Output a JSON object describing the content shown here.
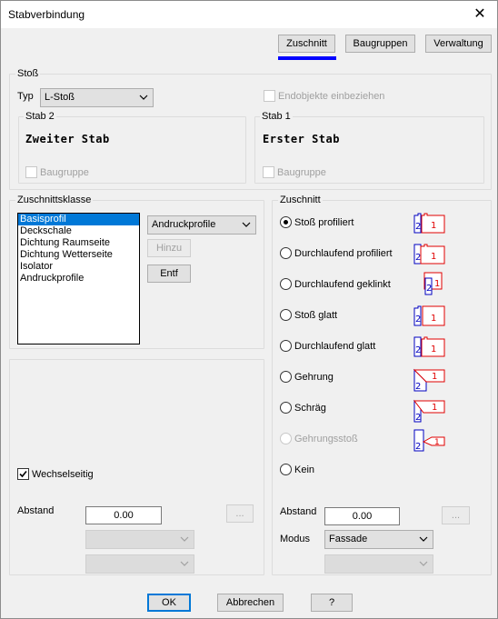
{
  "window": {
    "title": "Stabverbindung",
    "close_glyph": "✕"
  },
  "tabs": [
    {
      "label": "Zuschnitt",
      "active": true
    },
    {
      "label": "Baugruppen",
      "active": false
    },
    {
      "label": "Verwaltung",
      "active": false
    }
  ],
  "stoss": {
    "group_label": "Stoß",
    "typ_label": "Typ",
    "typ_value": "L-Stoß",
    "endobjekte_label": "Endobjekte einbeziehen",
    "stab2": {
      "label": "Stab 2",
      "name": "Zweiter Stab",
      "baugruppe_label": "Baugruppe"
    },
    "stab1": {
      "label": "Stab 1",
      "name": "Erster Stab",
      "baugruppe_label": "Baugruppe"
    }
  },
  "zuschnittsklasse": {
    "group_label": "Zuschnittsklasse",
    "items": [
      "Basisprofil",
      "Deckschale",
      "Dichtung Raumseite",
      "Dichtung Wetterseite",
      "Isolator",
      "Andruckprofile"
    ],
    "selected_index": 0,
    "combo_value": "Andruckprofile",
    "hinzu_label": "Hinzu",
    "entf_label": "Entf"
  },
  "left_lower": {
    "wechselseitig_label": "Wechselseitig",
    "abstand_label": "Abstand",
    "abstand_value": "0.00",
    "ellipsis_label": "..."
  },
  "zuschnitt": {
    "group_label": "Zuschnitt",
    "options": [
      {
        "label": "Stoß profiliert",
        "checked": true,
        "enabled": true
      },
      {
        "label": "Durchlaufend profiliert",
        "checked": false,
        "enabled": true
      },
      {
        "label": "Durchlaufend geklinkt",
        "checked": false,
        "enabled": true
      },
      {
        "label": "Stoß glatt",
        "checked": false,
        "enabled": true
      },
      {
        "label": "Durchlaufend glatt",
        "checked": false,
        "enabled": true
      },
      {
        "label": "Gehrung",
        "checked": false,
        "enabled": true
      },
      {
        "label": "Schräg",
        "checked": false,
        "enabled": true
      },
      {
        "label": "Gehrungsstoß",
        "checked": false,
        "enabled": false
      },
      {
        "label": "Kein",
        "checked": false,
        "enabled": true
      }
    ],
    "icon_num_blue": "2",
    "icon_num_red": "1",
    "abstand_label": "Abstand",
    "abstand_value": "0.00",
    "ellipsis_label": "...",
    "modus_label": "Modus",
    "modus_value": "Fassade"
  },
  "footer": {
    "ok_label": "OK",
    "cancel_label": "Abbrechen",
    "help_label": "?"
  },
  "colors": {
    "accent": "#0078d7",
    "tab_underline": "#0000ff",
    "icon_blue": "#0000c0",
    "icon_red": "#e00000"
  }
}
